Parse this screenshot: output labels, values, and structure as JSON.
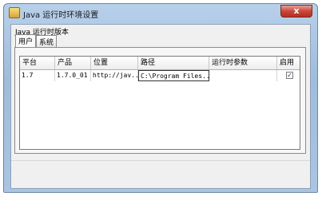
{
  "window": {
    "title": "Java 运行时环境设置",
    "close_label": "x"
  },
  "group": {
    "label": "Java 运行时版本"
  },
  "tabs": [
    {
      "label": "用户",
      "active": true
    },
    {
      "label": "系统",
      "active": false
    }
  ],
  "table": {
    "columns": [
      "平台",
      "产品",
      "位置",
      "路径",
      "运行时参数",
      "启用"
    ],
    "rows": [
      {
        "platform": "1.7",
        "product": "1.7.0_01",
        "location": "http://jav...",
        "path": "C:\\Program Files...",
        "runtime_params": "",
        "enabled": true,
        "enabled_mark": "✓"
      }
    ]
  }
}
